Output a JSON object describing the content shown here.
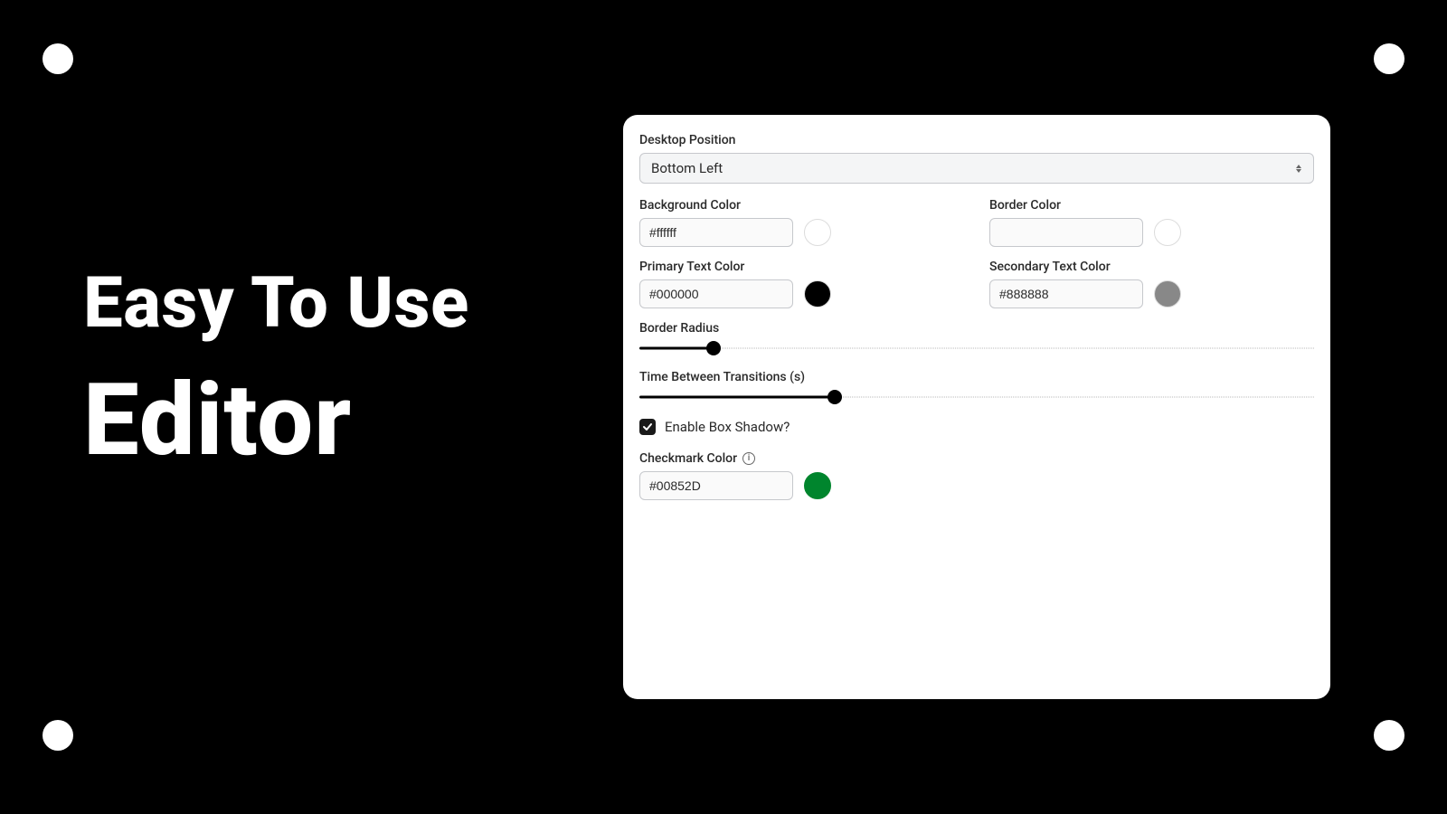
{
  "headline": {
    "line1": "Easy To Use",
    "line2": "Editor"
  },
  "panel": {
    "desktopPosition": {
      "label": "Desktop Position",
      "value": "Bottom Left"
    },
    "backgroundColor": {
      "label": "Background Color",
      "value": "#ffffff",
      "swatch": "#ffffff"
    },
    "borderColor": {
      "label": "Border Color",
      "value": "",
      "swatch": "#ffffff"
    },
    "primaryTextColor": {
      "label": "Primary Text Color",
      "value": "#000000",
      "swatch": "#000000"
    },
    "secondaryTextColor": {
      "label": "Secondary Text Color",
      "value": "#888888",
      "swatch": "#888888"
    },
    "borderRadius": {
      "label": "Border Radius",
      "percent": 11
    },
    "transitionTime": {
      "label": "Time Between Transitions (s)",
      "percent": 29
    },
    "enableBoxShadow": {
      "label": "Enable Box Shadow?",
      "checked": true
    },
    "checkmarkColor": {
      "label": "Checkmark Color",
      "value": "#00852D",
      "swatch": "#00852D"
    }
  }
}
